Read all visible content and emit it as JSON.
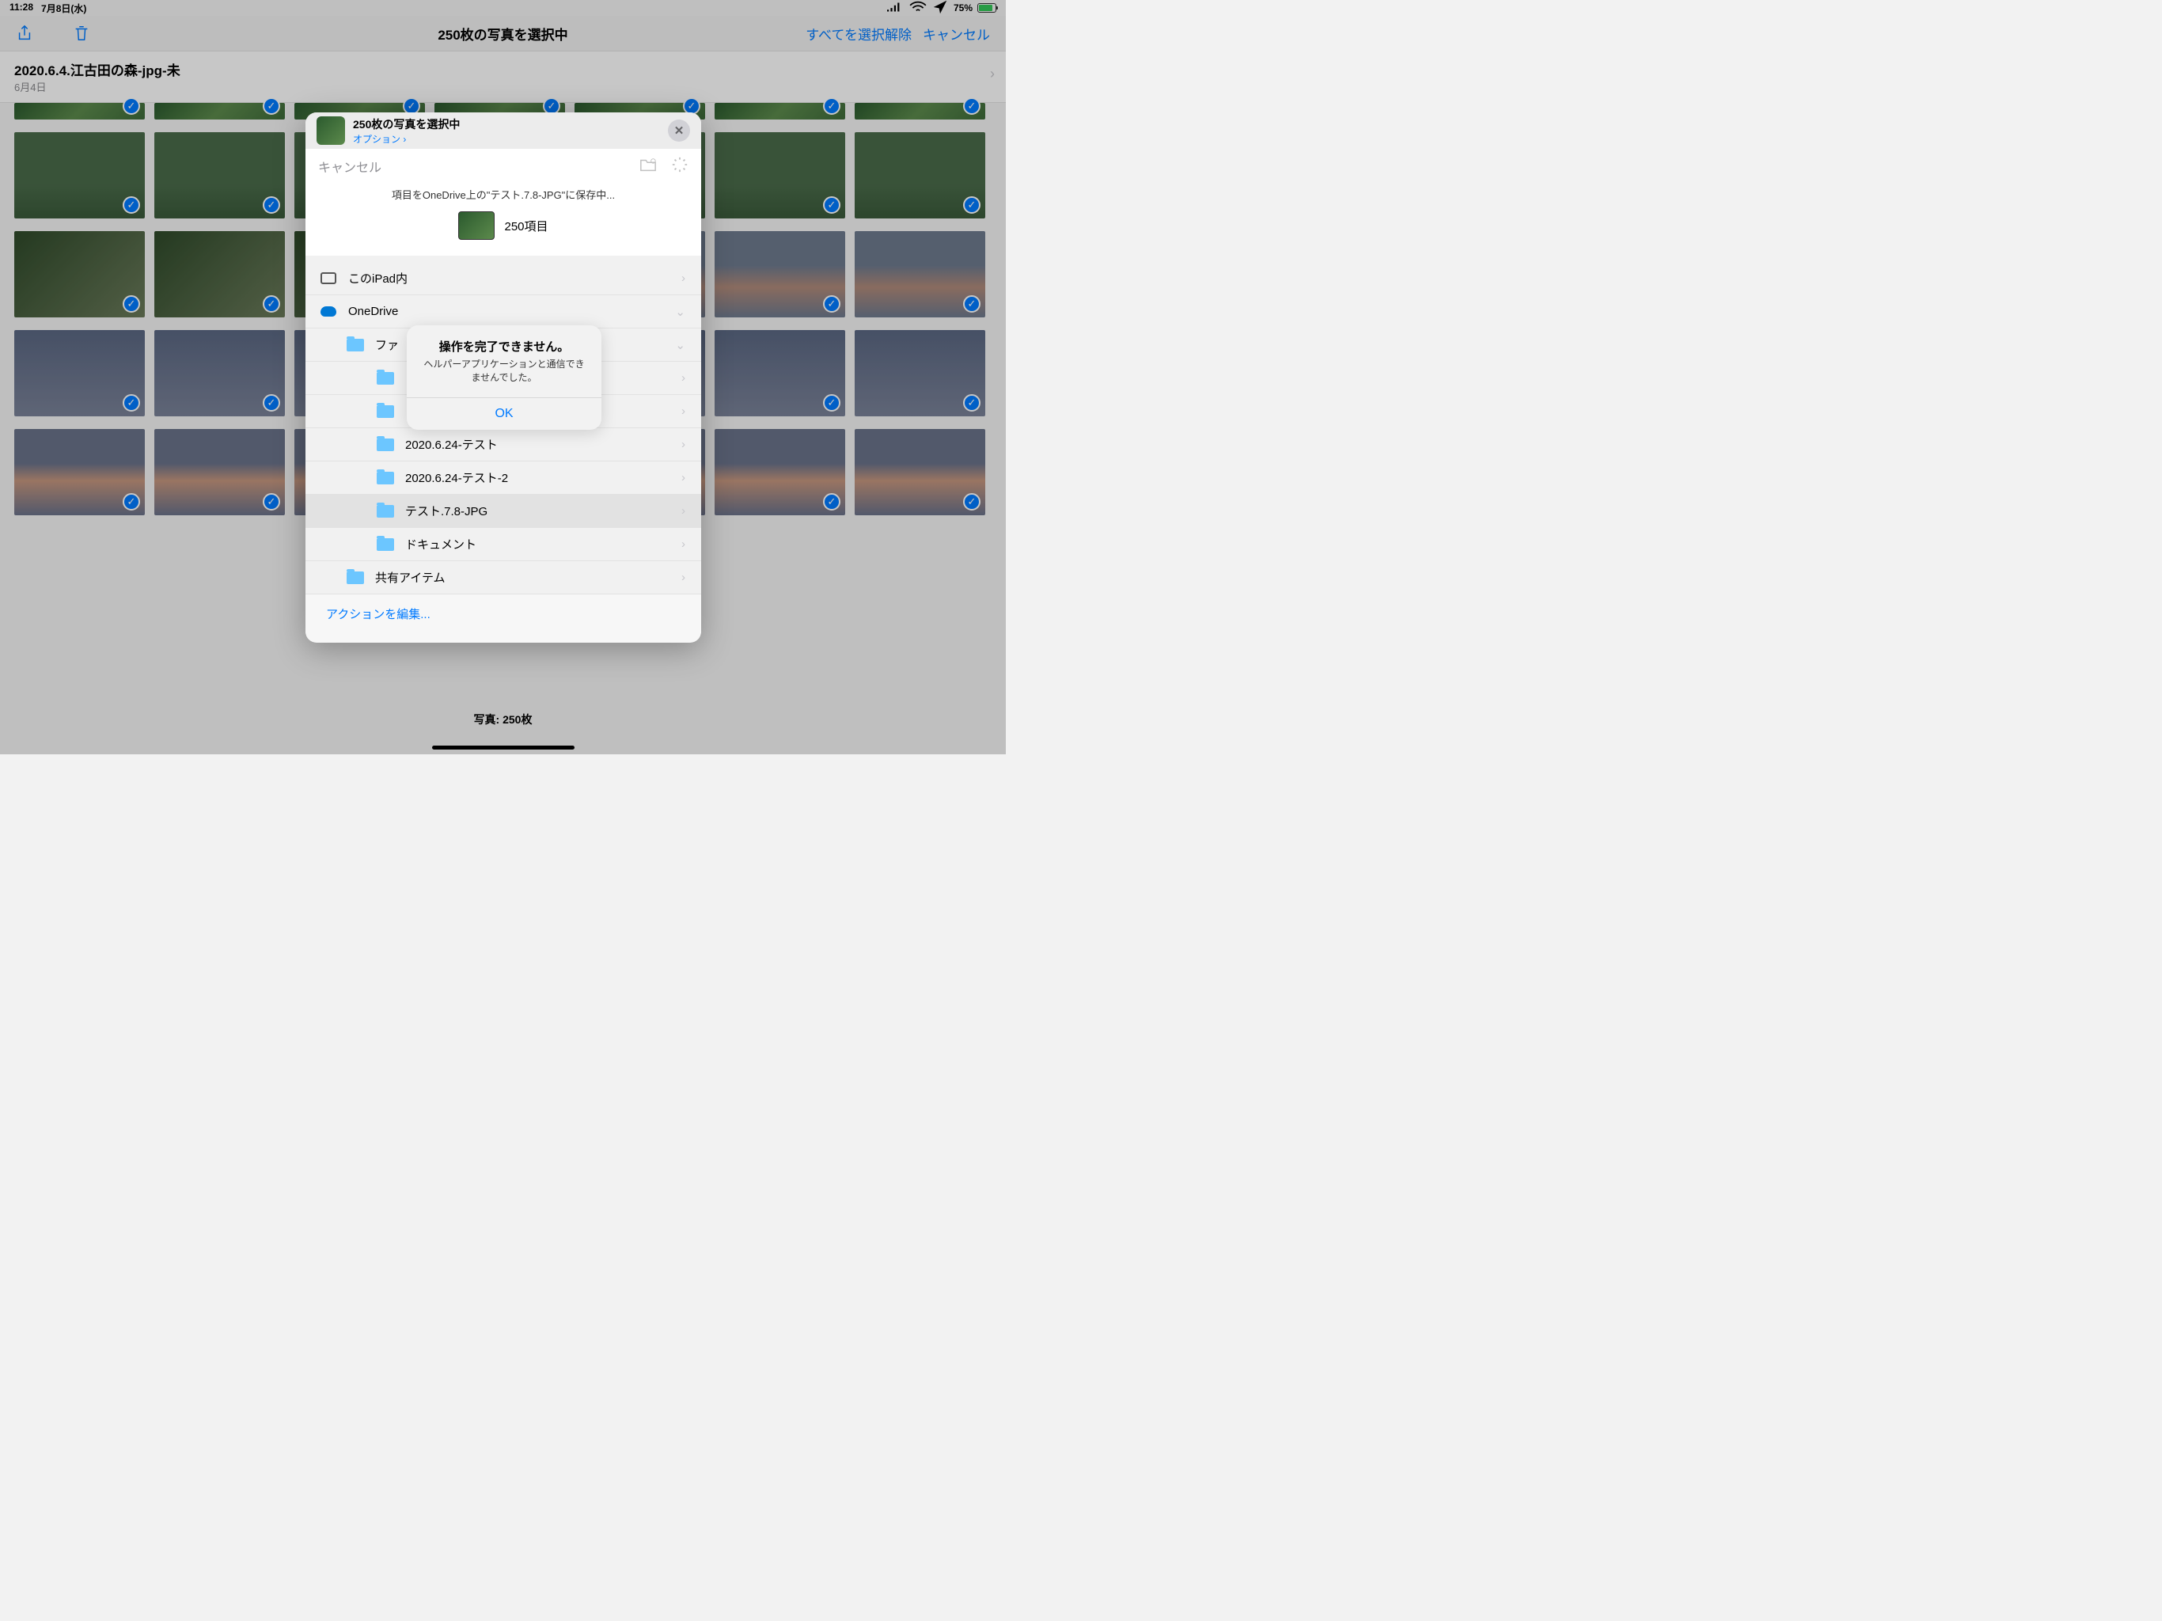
{
  "status": {
    "time": "11:28",
    "date": "7月8日(水)",
    "battery": "75%"
  },
  "nav": {
    "title": "250枚の写真を選択中",
    "deselect_all": "すべてを選択解除",
    "cancel": "キャンセル"
  },
  "album": {
    "name": "2020.6.4.江古田の森-jpg-未",
    "date": "6月4日"
  },
  "sheet": {
    "title": "250枚の写真を選択中",
    "options": "オプション ›",
    "cancel": "キャンセル",
    "saving_msg": "項目をOneDrive上の\"テスト.7.8-JPG\"に保存中...",
    "item_count": "250項目",
    "locations": [
      {
        "label": "このiPad内",
        "type": "ipad",
        "indent": 0,
        "chev": "›"
      },
      {
        "label": "OneDrive",
        "type": "onedrive",
        "indent": 0,
        "chev": "⌄"
      },
      {
        "label": "ファ",
        "type": "folder",
        "indent": 1,
        "chev": "⌄"
      },
      {
        "label": "",
        "type": "folder",
        "indent": 2,
        "chev": "›"
      },
      {
        "label": "",
        "type": "folder",
        "indent": 2,
        "chev": "›"
      },
      {
        "label": "2020.6.24-テスト",
        "type": "folder",
        "indent": 2,
        "chev": "›"
      },
      {
        "label": "2020.6.24-テスト-2",
        "type": "folder",
        "indent": 2,
        "chev": "›"
      },
      {
        "label": "テスト.7.8-JPG",
        "type": "folder",
        "indent": 2,
        "chev": "›",
        "selected": true
      },
      {
        "label": "ドキュメント",
        "type": "folder",
        "indent": 2,
        "chev": "›"
      },
      {
        "label": "共有アイテム",
        "type": "folder",
        "indent": 1,
        "chev": "›"
      }
    ],
    "edit_actions": "アクションを編集..."
  },
  "alert": {
    "title": "操作を完了できません。",
    "message": "ヘルパーアプリケーションと通信できませんでした。",
    "ok": "OK"
  },
  "footer": {
    "count": "写真: 250枚"
  },
  "rows": [
    {
      "cls": "green-bush",
      "half": true,
      "n": 7
    },
    {
      "cls": "flowers",
      "n": 7
    },
    {
      "cls": "vines",
      "mix": [
        "vines",
        "vines",
        "vines",
        "sky-evening",
        "sky-evening",
        "sky-evening",
        "sky-evening"
      ],
      "n": 7
    },
    {
      "cls": "sky-dusk",
      "n": 7
    },
    {
      "cls": "sky-pink",
      "n": 7
    }
  ]
}
